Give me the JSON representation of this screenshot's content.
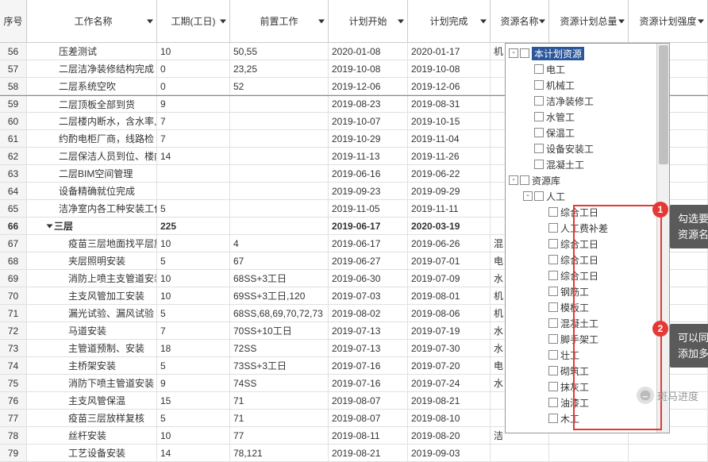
{
  "columns": {
    "seq": "序号",
    "name": "工作名称",
    "dur": "工期(工日)",
    "pred": "前置工作",
    "start": "计划开始",
    "end": "计划完成",
    "res": "资源名称",
    "qty": "资源计划总量",
    "int": "资源计划强度"
  },
  "rows": [
    {
      "seq": "56",
      "name": "压差测试",
      "dur": "10",
      "pred": "50,55",
      "start": "2020-01-08",
      "end": "2020-01-17",
      "res": "机"
    },
    {
      "seq": "57",
      "name": "二层洁净装修结构完成",
      "dur": "0",
      "pred": "23,25",
      "start": "2019-10-08",
      "end": "2019-10-08"
    },
    {
      "seq": "58",
      "name": "二层系统空吹",
      "dur": "0",
      "pred": "52",
      "start": "2019-12-06",
      "end": "2019-12-06"
    },
    {
      "seq": "59",
      "name": "二层顶板全部到货",
      "dur": "9",
      "pred": "",
      "start": "2019-08-23",
      "end": "2019-08-31",
      "sep": true
    },
    {
      "seq": "60",
      "name": "二层楼内断水，含水率,",
      "dur": "7",
      "pred": "",
      "start": "2019-10-07",
      "end": "2019-10-15"
    },
    {
      "seq": "61",
      "name": "约酌电柜厂商，线路检",
      "dur": "7",
      "pred": "",
      "start": "2019-10-29",
      "end": "2019-11-04"
    },
    {
      "seq": "62",
      "name": "二层保洁人员到位、楼内",
      "dur": "14",
      "pred": "",
      "start": "2019-11-13",
      "end": "2019-11-26"
    },
    {
      "seq": "63",
      "name": "二层BIM空间管理",
      "dur": "",
      "pred": "",
      "start": "2019-06-16",
      "end": "2019-06-22"
    },
    {
      "seq": "64",
      "name": "设备精确就位完成",
      "dur": "",
      "pred": "",
      "start": "2019-09-23",
      "end": "2019-09-29"
    },
    {
      "seq": "65",
      "name": "洁净室内各工种安装工作",
      "dur": "5",
      "pred": "",
      "start": "2019-11-05",
      "end": "2019-11-11"
    },
    {
      "seq": "66",
      "name": "三层",
      "dur": "225",
      "pred": "",
      "start": "2019-06-17",
      "end": "2020-03-19",
      "bold": true,
      "tri": true
    },
    {
      "seq": "67",
      "name": "疫苗三层地面找平层施工",
      "dur": "10",
      "pred": "4",
      "start": "2019-06-17",
      "end": "2019-06-26",
      "res": "混"
    },
    {
      "seq": "68",
      "name": "夹层照明安装",
      "dur": "5",
      "pred": "67",
      "start": "2019-06-27",
      "end": "2019-07-01",
      "res": "电"
    },
    {
      "seq": "69",
      "name": "消防上喷主支管道安装",
      "dur": "10",
      "pred": "68SS+3工日",
      "start": "2019-06-30",
      "end": "2019-07-09",
      "res": "水"
    },
    {
      "seq": "70",
      "name": "主支风管加工安装",
      "dur": "10",
      "pred": "69SS+3工日,120",
      "start": "2019-07-03",
      "end": "2019-08-01",
      "res": "机"
    },
    {
      "seq": "71",
      "name": "漏光试验、漏风试验",
      "dur": "5",
      "pred": "68SS,68,69,70,72,73",
      "start": "2019-08-02",
      "end": "2019-08-06",
      "res": "机"
    },
    {
      "seq": "72",
      "name": "马道安装",
      "dur": "7",
      "pred": "70SS+10工日",
      "start": "2019-07-13",
      "end": "2019-07-19",
      "res": "水"
    },
    {
      "seq": "73",
      "name": "主管道预制、安装",
      "dur": "18",
      "pred": "72SS",
      "start": "2019-07-13",
      "end": "2019-07-30",
      "res": "水"
    },
    {
      "seq": "74",
      "name": "主桥架安装",
      "dur": "5",
      "pred": "73SS+3工日",
      "start": "2019-07-16",
      "end": "2019-07-20",
      "res": "电"
    },
    {
      "seq": "75",
      "name": "消防下喷主管道安装",
      "dur": "9",
      "pred": "74SS",
      "start": "2019-07-16",
      "end": "2019-07-24",
      "res": "水"
    },
    {
      "seq": "76",
      "name": "主支风管保温",
      "dur": "15",
      "pred": "71",
      "start": "2019-08-07",
      "end": "2019-08-21"
    },
    {
      "seq": "77",
      "name": "疫苗三层放样复核",
      "dur": "5",
      "pred": "71",
      "start": "2019-08-07",
      "end": "2019-08-10"
    },
    {
      "seq": "78",
      "name": "丝杆安装",
      "dur": "10",
      "pred": "77",
      "start": "2019-08-11",
      "end": "2019-08-20",
      "res": "洁"
    },
    {
      "seq": "79",
      "name": "工艺设备安装",
      "dur": "14",
      "pred": "78,121",
      "start": "2019-08-21",
      "end": "2019-09-03"
    }
  ],
  "tree": {
    "root": "本计划资源",
    "grp1": [
      "电工",
      "机械工",
      "洁净装修工",
      "水管工",
      "保温工",
      "设备安装工",
      "混凝土工"
    ],
    "lib": "资源库",
    "labor": "人工",
    "grp2": [
      "综合工日",
      "人工费补差",
      "综合工日",
      "综合工日",
      "综合工日",
      "钢筋工",
      "模板工",
      "混凝土工",
      "脚手架工",
      "壮工",
      "砌筑工",
      "抹灰工",
      "油漆工",
      "木工"
    ]
  },
  "callouts": {
    "n1": "1",
    "t1a": "勾选要添加的",
    "t1b": "资源名称",
    "n2": "2",
    "t2a": "可以同时勾选",
    "t2b": "添加多个"
  },
  "brand": "斑马进度"
}
